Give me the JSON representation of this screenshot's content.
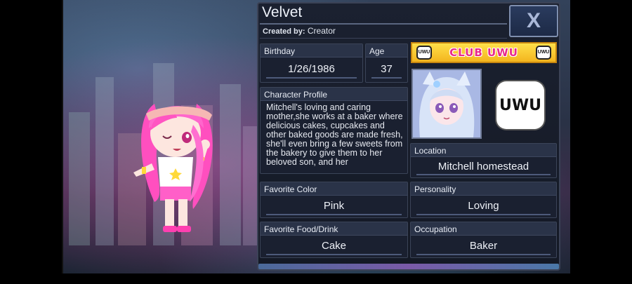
{
  "character": {
    "name": "Velvet",
    "created_by_label": "Created by:",
    "creator": "Creator"
  },
  "close_button": {
    "label": "X",
    "icon": "close-icon"
  },
  "fields": {
    "birthday": {
      "label": "Birthday",
      "value": "1/26/1986"
    },
    "age": {
      "label": "Age",
      "value": "37"
    },
    "profile": {
      "label": "Character Profile",
      "text": "Mitchell's loving and caring mother,she works at a baker where delicious cakes, cupcakes and other baked goods are made fresh, she'll even bring a few sweets from the bakery to give them to her beloved son, and her"
    },
    "location": {
      "label": "Location",
      "value": "Mitchell homestead"
    },
    "favorite_color": {
      "label": "Favorite Color",
      "value": "Pink"
    },
    "personality": {
      "label": "Personality",
      "value": "Loving"
    },
    "favorite_food": {
      "label": "Favorite Food/Drink",
      "value": "Cake"
    },
    "occupation": {
      "label": "Occupation",
      "value": "Baker"
    }
  },
  "club": {
    "banner": "CLUB UWU",
    "badge_text": "UWU",
    "logo_text": "UWU"
  },
  "colors": {
    "panel_bg": "#1b2130",
    "label_bg": "#2a3348",
    "club_yellow": "#ffe04a",
    "club_pink": "#e8298b",
    "hair_pink": "#ff5fc8"
  }
}
